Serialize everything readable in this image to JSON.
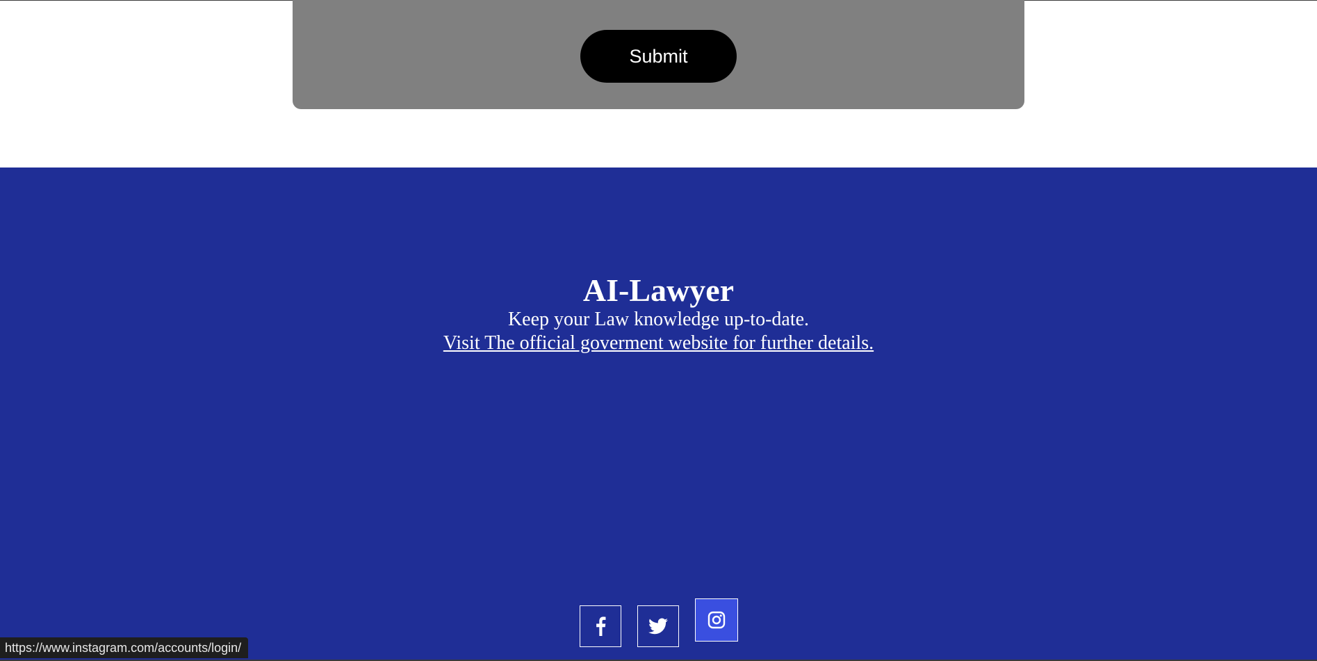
{
  "form": {
    "submit_label": "Submit"
  },
  "footer": {
    "title": "AI-Lawyer",
    "tagline": "Keep your Law knowledge up-to-date.",
    "link_text": "Visit The official goverment website for further details.",
    "background_color": "#1f2e96",
    "social": [
      {
        "icon": "facebook-icon"
      },
      {
        "icon": "twitter-icon"
      },
      {
        "icon": "instagram-icon",
        "state": "hovered"
      }
    ]
  },
  "status_bar": {
    "url": "https://www.instagram.com/accounts/login/"
  },
  "colors": {
    "form_panel": "#808080",
    "submit_button": "#000000",
    "instagram_hover": "#3a4fe0"
  }
}
